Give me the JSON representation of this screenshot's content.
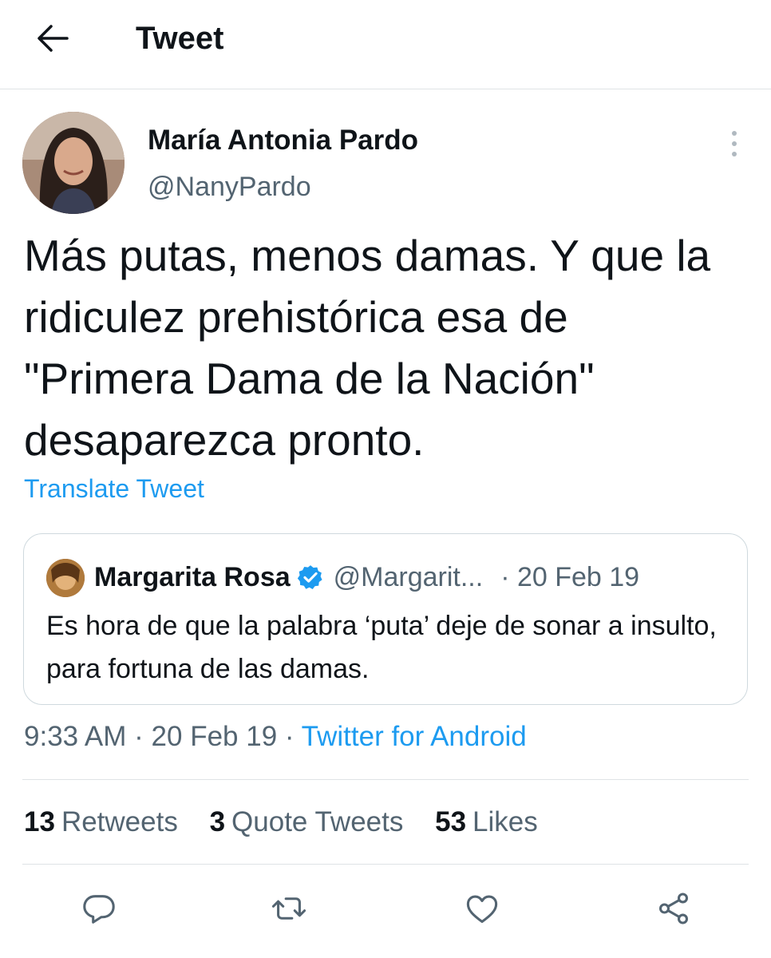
{
  "header": {
    "title": "Tweet",
    "back_icon": "arrow-left-icon"
  },
  "tweet": {
    "author_name": "María Antonia Pardo",
    "author_handle": "@NanyPardo",
    "text": "Más putas, menos damas. Y que la ridiculez prehistórica esa de \"Primera Dama de la Nación\" desaparezca pronto.",
    "translate_label": "Translate Tweet",
    "time": "9:33 AM",
    "date": "20 Feb 19",
    "source": "Twitter for Android"
  },
  "quoted_tweet": {
    "author_name": "Margarita Rosa",
    "verified": true,
    "author_handle": "@Margarit...",
    "date": "· 20 Feb 19",
    "text": "Es hora de que la palabra ‘puta’ deje de sonar a insulto, para fortuna de las damas."
  },
  "stats": {
    "retweets_count": "13",
    "retweets_label": "Retweets",
    "quotes_count": "3",
    "quotes_label": "Quote Tweets",
    "likes_count": "53",
    "likes_label": "Likes"
  },
  "actions": [
    "reply-icon",
    "retweet-icon",
    "like-icon",
    "share-icon"
  ],
  "colors": {
    "link": "#1d9bf0",
    "secondary_text": "#536471",
    "primary_text": "#0f1419",
    "divider": "#dfe3e6"
  }
}
